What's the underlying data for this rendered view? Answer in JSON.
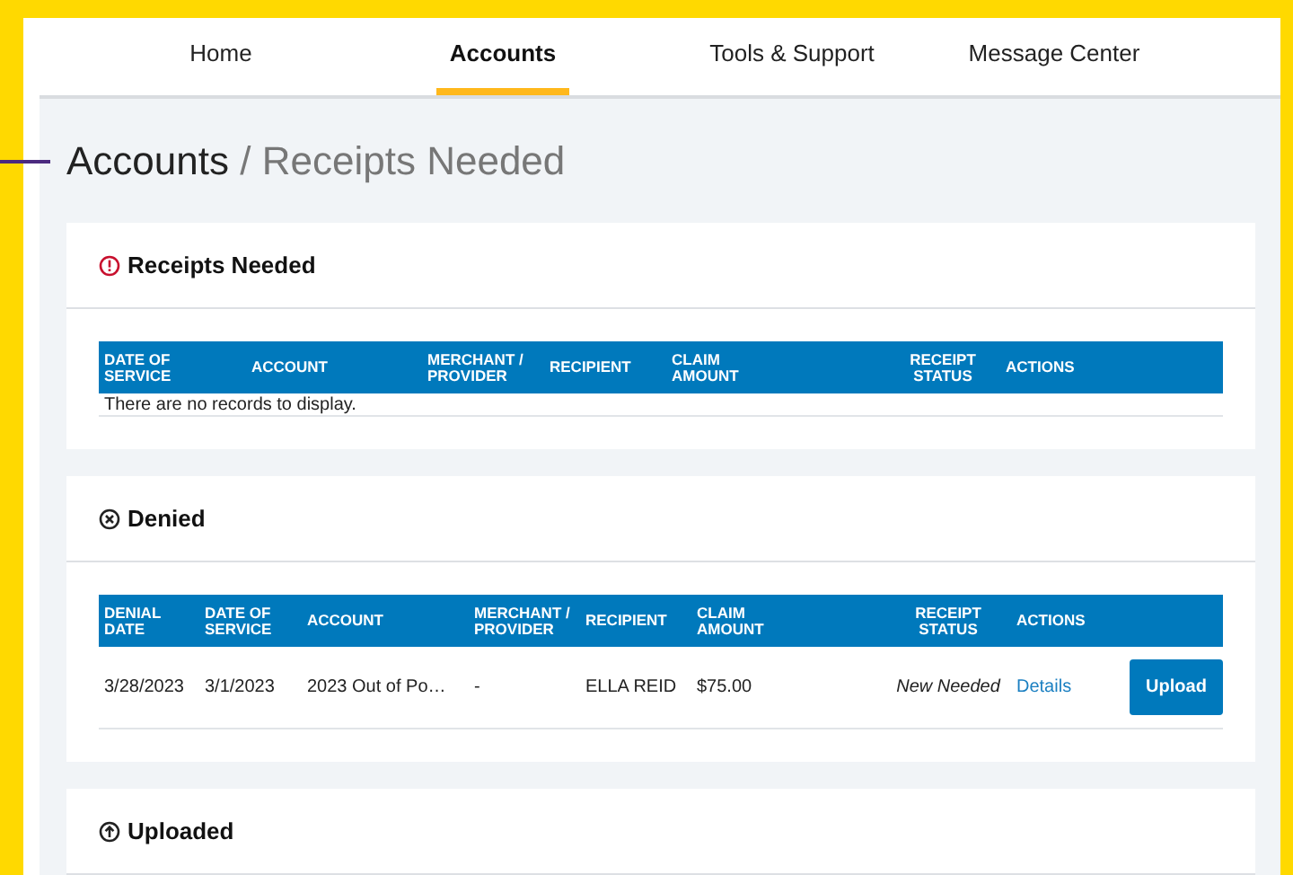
{
  "nav": {
    "tabs": [
      {
        "label": "Home",
        "selected": false
      },
      {
        "label": "Accounts",
        "selected": true
      },
      {
        "label": "Tools & Support",
        "selected": false
      },
      {
        "label": "Message Center",
        "selected": false
      }
    ]
  },
  "breadcrumb": {
    "parent": "Accounts",
    "separator": "/",
    "current": "Receipts Needed"
  },
  "sections": [
    {
      "kind": "alert",
      "title": "Receipts Needed",
      "table": {
        "columns": [
          "DATE OF SERVICE",
          "ACCOUNT",
          "MERCHANT / PROVIDER",
          "RECIPIENT",
          "CLAIM AMOUNT",
          "RECEIPT STATUS",
          "ACTIONS"
        ],
        "empty_message": "There are no records to display."
      }
    },
    {
      "kind": "denied",
      "title": "Denied",
      "table": {
        "columns": [
          "DENIAL DATE",
          "DATE OF SERVICE",
          "ACCOUNT",
          "MERCHANT / PROVIDER",
          "RECIPIENT",
          "CLAIM AMOUNT",
          "RECEIPT STATUS",
          "ACTIONS"
        ],
        "rows": [
          {
            "cells": [
              {
                "kind": "text",
                "text": "3/28/2023"
              },
              {
                "kind": "text",
                "text": "3/1/2023"
              },
              {
                "kind": "text",
                "text": "2023 Out of Po…"
              },
              {
                "kind": "text",
                "text": "-"
              },
              {
                "kind": "text",
                "text": "ELLA REID"
              },
              {
                "kind": "text",
                "text": "$75.00"
              },
              {
                "kind": "status",
                "text": "New Needed"
              },
              {
                "kind": "link",
                "text": "Details"
              },
              {
                "kind": "button",
                "text": "Upload"
              }
            ]
          }
        ]
      }
    },
    {
      "kind": "uploaded",
      "title": "Uploaded"
    }
  ]
}
